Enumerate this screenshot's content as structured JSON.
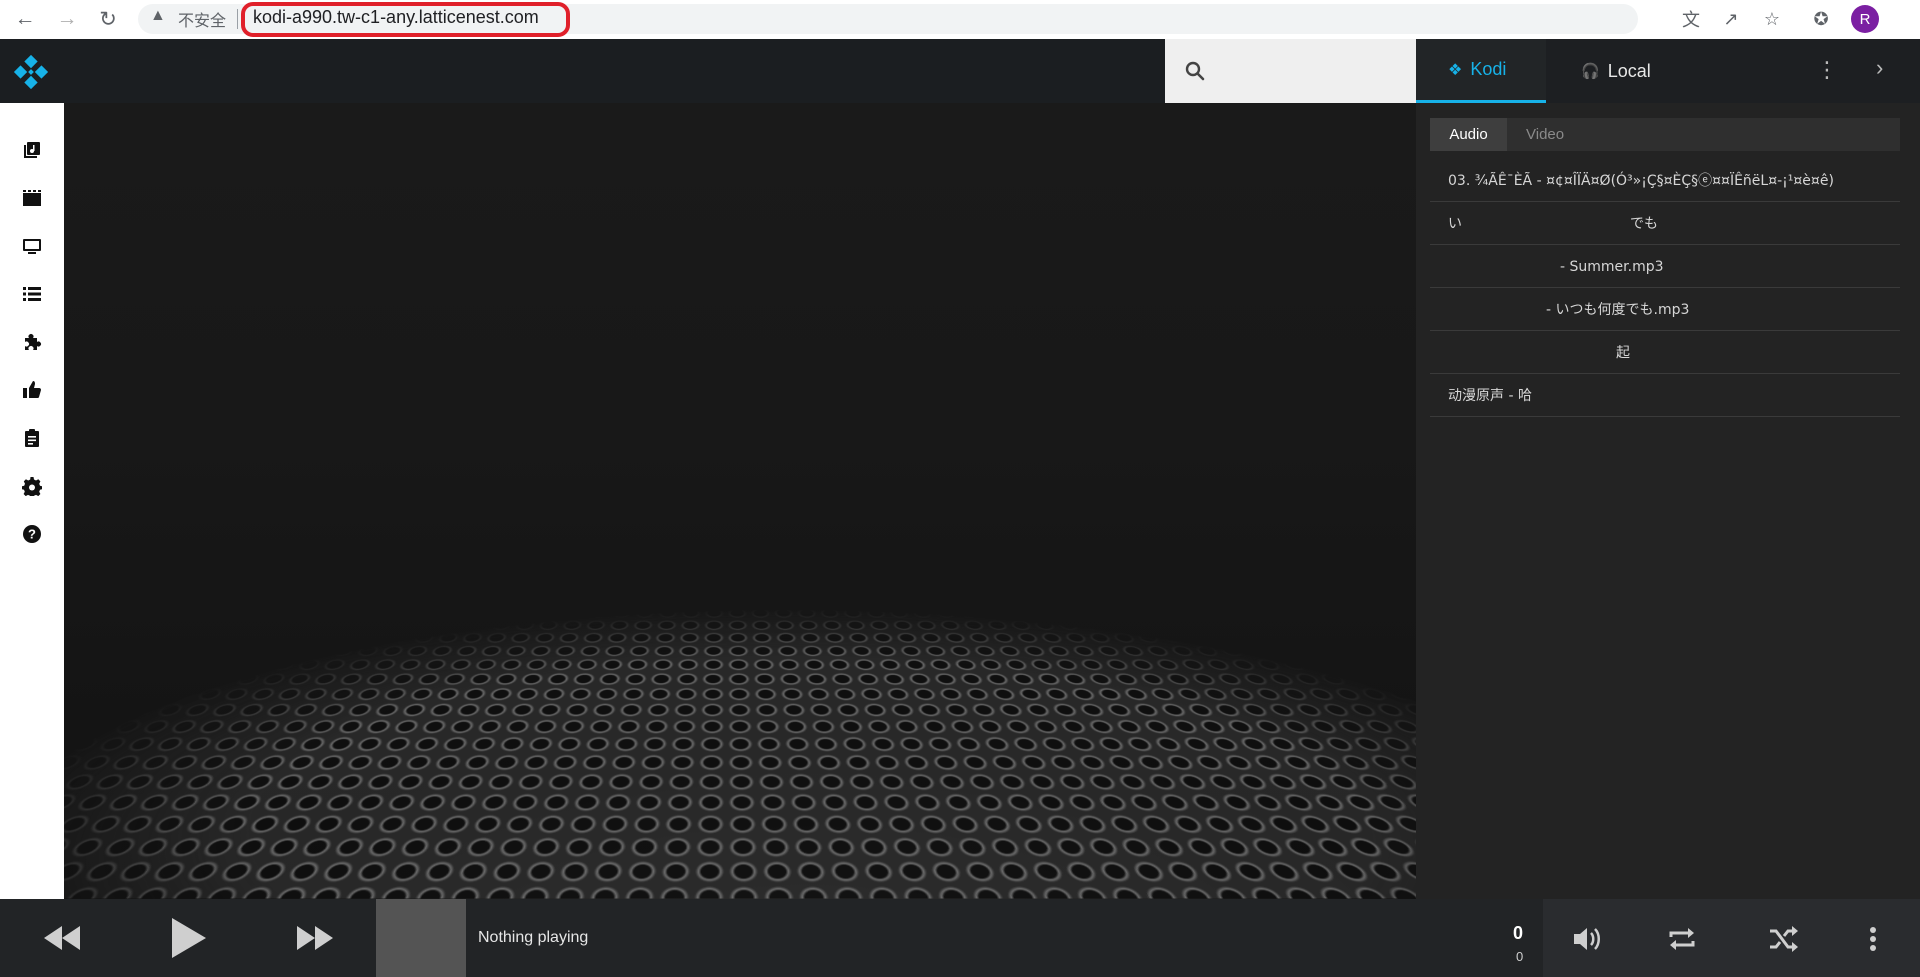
{
  "browser": {
    "insecure_label": "不安全",
    "url": "kodi-a990.tw-c1-any.latticenest.com",
    "profile_initial": "R",
    "icons": [
      "back-icon",
      "forward-icon",
      "reload-icon",
      "warning-icon",
      "translate-icon",
      "share-icon",
      "bookmark-star-icon",
      "extensions-icon"
    ]
  },
  "header": {
    "tabs": [
      {
        "label": "Kodi",
        "icon": "kodi-icon",
        "active": true
      },
      {
        "label": "Local",
        "icon": "headphones-icon",
        "active": false
      }
    ]
  },
  "sidebar": {
    "items": [
      "music-library-icon",
      "movies-icon",
      "tv-icon",
      "playlist-icon",
      "addons-icon",
      "thumbs-up-icon",
      "clipboard-icon",
      "settings-icon",
      "help-icon"
    ]
  },
  "playlist": {
    "subtabs": [
      "Audio",
      "Video"
    ],
    "active_subtab": "Audio",
    "items": [
      "03. ¾ÃÊ¯ÈÃ - ¤¢¤ÎÏÄ¤Ø(Ó³»¡Ç§¤ÈÇ§ⓔ¤¤ÏÊñëL¤-¡¹¤è¤ê)",
      "い　　　　　　　　　　　　でも",
      "　　　　　　　　- Summer.mp3",
      "　　　　　　　- いつも何度でも.mp3",
      "　　　　　　　　　　　　起",
      "动漫原声 - 哈"
    ]
  },
  "player": {
    "now_playing": "Nothing playing",
    "count_primary": "0",
    "count_secondary": "0"
  },
  "colors": {
    "accent": "#17b2e8",
    "url_highlight": "#e0202a"
  }
}
